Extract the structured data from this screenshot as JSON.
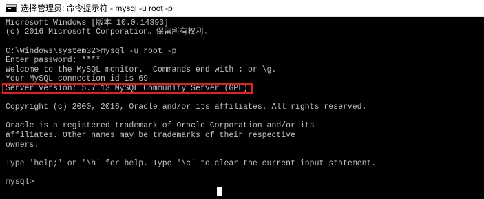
{
  "window": {
    "title": "选择管理员: 命令提示符 - mysql  -u root -p",
    "icon": "console-window-icon"
  },
  "console": {
    "lines": [
      "Microsoft Windows [版本 10.0.14393]",
      "(c) 2016 Microsoft Corporation。保留所有权利。",
      "",
      "C:\\Windows\\system32>mysql -u root -p",
      "Enter password: ****",
      "Welcome to the MySQL monitor.  Commands end with ; or \\g.",
      "Your MySQL connection id is 69",
      "Server version: 5.7.13 MySQL Community Server (GPL)",
      "",
      "Copyright (c) 2000, 2016, Oracle and/or its affiliates. All rights reserved.",
      "",
      "Oracle is a registered trademark of Oracle Corporation and/or its",
      "affiliates. Other names may be trademarks of their respective",
      "owners.",
      "",
      "Type 'help;' or '\\h' for help. Type '\\c' to clear the current input statement.",
      "",
      "mysql>"
    ],
    "highlighted_line": "Server version: 5.7.13 MySQL Community Server (GPL)",
    "highlight_color": "#e02020",
    "text_color": "#c0c0c0",
    "background_color": "#000000"
  }
}
